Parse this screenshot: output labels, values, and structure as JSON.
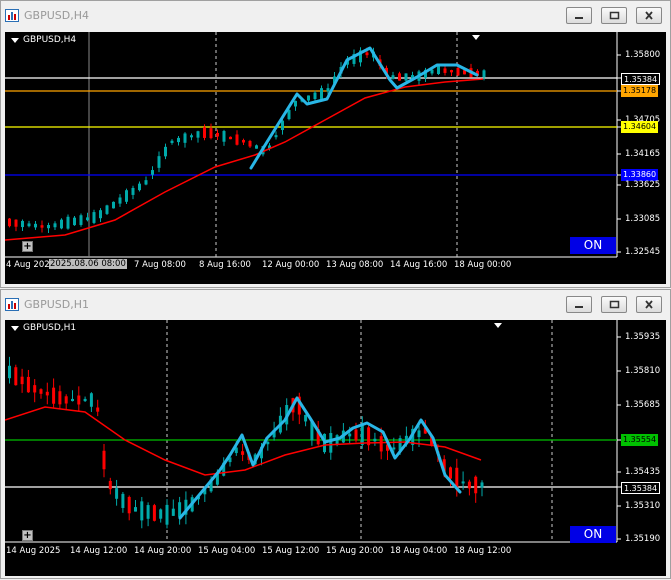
{
  "windows": [
    {
      "title": "GBPUSD,H4",
      "symbol_label": "GBPUSD,H4",
      "on_label": "ON",
      "price_ticks": [
        "1.35800",
        "1.35384",
        "1.35178",
        "1.34705",
        "1.34604",
        "1.34165",
        "1.33860",
        "1.33625",
        "1.33085",
        "1.32545"
      ],
      "time_ticks": [
        "4 Aug 202",
        "7 Aug 08:00",
        "8 Aug 16:00",
        "12 Aug 00:00",
        "13 Aug 08:00",
        "14 Aug 16:00",
        "18 Aug 00:00"
      ],
      "highlighted_time": "2025.08.06 08:00",
      "levels": [
        {
          "price": "1.35384",
          "color": "#ffffff"
        },
        {
          "price": "1.35178",
          "color": "#ffa500"
        },
        {
          "price": "1.34604",
          "color": "#ffff00"
        },
        {
          "price": "1.33860",
          "color": "#0000ff"
        }
      ]
    },
    {
      "title": "GBPUSD,H1",
      "symbol_label": "GBPUSD,H1",
      "on_label": "ON",
      "price_ticks": [
        "1.35935",
        "1.35810",
        "1.35685",
        "1.35554",
        "1.35435",
        "1.35384",
        "1.35310",
        "1.35190"
      ],
      "time_ticks": [
        "14 Aug 2025",
        "14 Aug 12:00",
        "14 Aug 20:00",
        "15 Aug 04:00",
        "15 Aug 12:00",
        "15 Aug 20:00",
        "18 Aug 04:00",
        "18 Aug 12:00"
      ],
      "levels": [
        {
          "price": "1.35554",
          "color": "#00c000"
        },
        {
          "price": "1.35384",
          "color": "#ffffff"
        }
      ]
    }
  ],
  "colors": {
    "bull": "#00aaaa",
    "bear": "#ff0000",
    "ma": "#ff0000",
    "zigzag": "#29b6e6",
    "on_button": "#0000e6"
  }
}
